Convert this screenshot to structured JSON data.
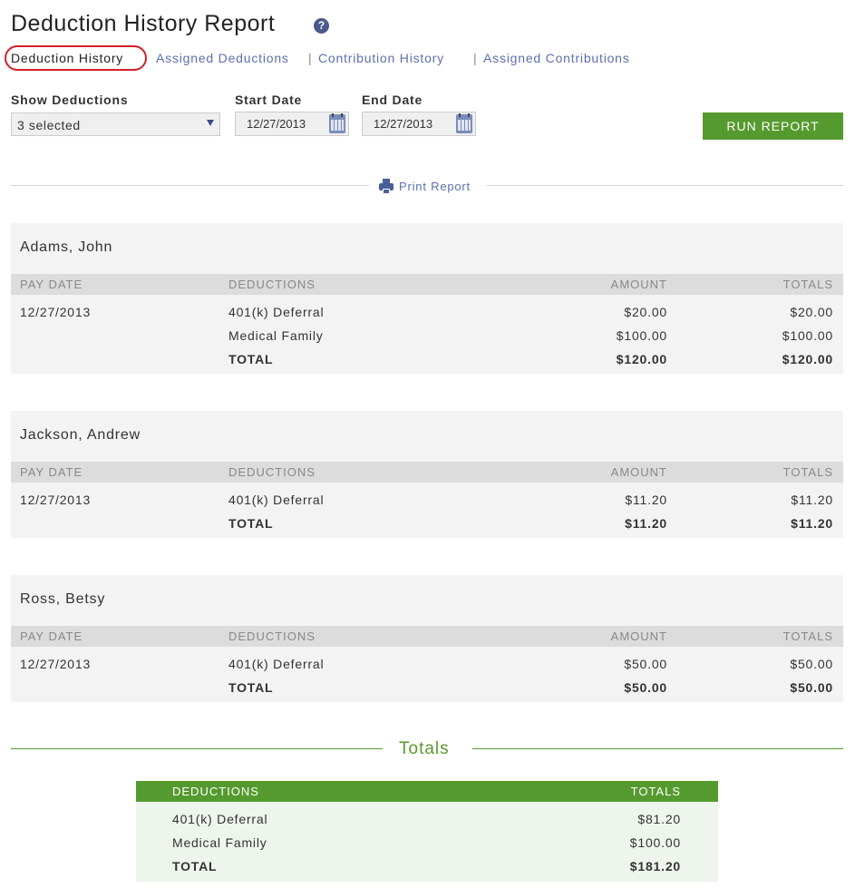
{
  "page": {
    "title": "Deduction History Report",
    "help": "?"
  },
  "nav": {
    "active": "Deduction History",
    "links": [
      "Assigned Deductions",
      "Contribution History",
      "Assigned Contributions"
    ],
    "separator": "|"
  },
  "filters": {
    "show_deductions_label": "Show Deductions",
    "show_deductions_value": "3 selected",
    "start_date_label": "Start Date",
    "start_date_value": "12/27/2013",
    "end_date_label": "End Date",
    "end_date_value": "12/27/2013",
    "run_button": "RUN REPORT"
  },
  "print": {
    "label": "Print Report"
  },
  "columns": {
    "pay_date": "PAY DATE",
    "deductions": "DEDUCTIONS",
    "amount": "AMOUNT",
    "totals": "TOTALS"
  },
  "employees": [
    {
      "name": "Adams, John",
      "pay_date": "12/27/2013",
      "rows": [
        {
          "deduction": "401(k) Deferral",
          "amount": "$20.00",
          "total": "$20.00"
        },
        {
          "deduction": "Medical Family",
          "amount": "$100.00",
          "total": "$100.00"
        }
      ],
      "total_label": "TOTAL",
      "total_amount": "$120.00",
      "total_total": "$120.00"
    },
    {
      "name": "Jackson, Andrew",
      "pay_date": "12/27/2013",
      "rows": [
        {
          "deduction": "401(k) Deferral",
          "amount": "$11.20",
          "total": "$11.20"
        }
      ],
      "total_label": "TOTAL",
      "total_amount": "$11.20",
      "total_total": "$11.20"
    },
    {
      "name": "Ross, Betsy",
      "pay_date": "12/27/2013",
      "rows": [
        {
          "deduction": "401(k) Deferral",
          "amount": "$50.00",
          "total": "$50.00"
        }
      ],
      "total_label": "TOTAL",
      "total_amount": "$50.00",
      "total_total": "$50.00"
    }
  ],
  "totals": {
    "title": "Totals",
    "head_deductions": "DEDUCTIONS",
    "head_totals": "TOTALS",
    "rows": [
      {
        "deduction": "401(k) Deferral",
        "total": "$81.20"
      },
      {
        "deduction": "Medical Family",
        "total": "$100.00"
      }
    ],
    "total_label": "TOTAL",
    "total_value": "$181.20"
  },
  "colors": {
    "accent_green": "#559a2e",
    "link_blue": "#5a6fb0",
    "highlight_red": "#d0202a"
  }
}
